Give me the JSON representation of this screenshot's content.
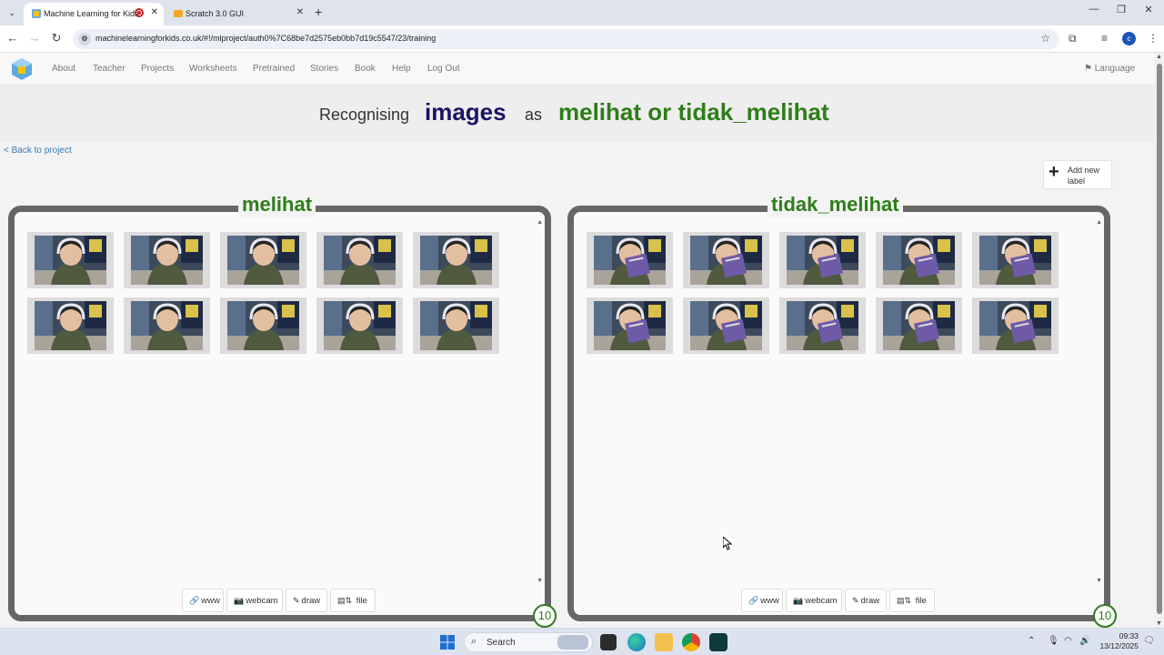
{
  "browser": {
    "tabs": [
      {
        "title": "Machine Learning for Kids",
        "active": true
      },
      {
        "title": "Scratch 3.0 GUI",
        "active": false
      }
    ],
    "url": "machinelearningforkids.co.uk/#!/mlproject/auth0%7C68be7d2575eb0bb7d19c5547/23/training",
    "profile_initial": "c"
  },
  "site_nav": {
    "links": [
      "About",
      "Teacher",
      "Projects",
      "Worksheets",
      "Pretrained",
      "Stories",
      "Book",
      "Help",
      "Log Out"
    ],
    "language": "Language"
  },
  "headline": {
    "prefix": "Recognising",
    "type": "images",
    "mid": "as",
    "labels": "melihat or tidak_melihat"
  },
  "back_link": "< Back to project",
  "add_label": "Add new label",
  "buckets": [
    {
      "name": "melihat",
      "count": "10",
      "image_count": 10
    },
    {
      "name": "tidak_melihat",
      "count": "10",
      "image_count": 10
    }
  ],
  "tools": {
    "www": "www",
    "webcam": "webcam",
    "draw": "draw",
    "file": "file"
  },
  "taskbar": {
    "search_label": "Search",
    "time": "09:33",
    "date": "13/12/2025"
  },
  "colors": {
    "label_green": "#2e7d1a",
    "type_navy": "#1b1464",
    "bucket_border": "#666666"
  }
}
